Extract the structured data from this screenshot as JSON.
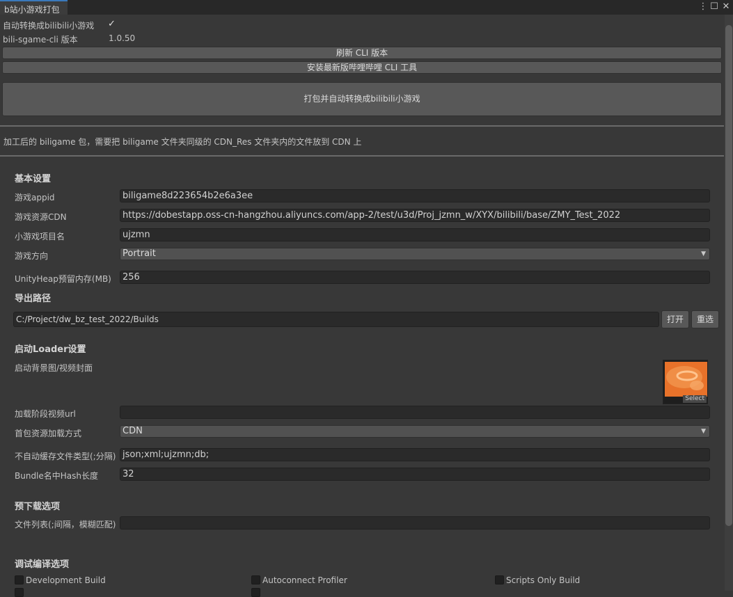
{
  "window": {
    "tab_title": "b站小游戏打包",
    "menu_icon": "⋮",
    "maximize_icon": "☐",
    "close_icon": "✕"
  },
  "top": {
    "auto_convert_label": "自动转换成bilibili小游戏",
    "auto_convert_checked": true,
    "checkmark": "✓",
    "cli_version_label": "bili-sgame-cli 版本",
    "cli_version_value": "1.0.50",
    "refresh_cli_button": "刷新 CLI 版本",
    "install_cli_button": "安装最新版哔哩哔哩 CLI 工具",
    "build_button": "打包并自动转换成bilibili小游戏",
    "note": "加工后的 biligame 包，需要把 biligame 文件夹同级的 CDN_Res 文件夹内的文件放到 CDN 上"
  },
  "basic": {
    "header": "基本设置",
    "appid_label": "游戏appid",
    "appid_value": "biligame8d223654b2e6a3ee",
    "cdn_label": "游戏资源CDN",
    "cdn_value": "https://dobestapp.oss-cn-hangzhou.aliyuncs.com/app-2/test/u3d/Proj_jzmn_w/XYX/bilibili/base/ZMY_Test_2022",
    "project_label": "小游戏项目名",
    "project_value": "ujzmn",
    "orientation_label": "游戏方向",
    "orientation_value": "Portrait",
    "heap_label": "UnityHeap预留内存(MB)",
    "heap_value": "256"
  },
  "export": {
    "header": "导出路径",
    "path_value": "C:/Project/dw_bz_test_2022/Builds",
    "open_button": "打开",
    "reselect_button": "重选"
  },
  "loader": {
    "header": "启动Loader设置",
    "bg_label": "启动背景图/视频封面",
    "select_label": "Select",
    "video_url_label": "加载阶段视频url",
    "video_url_value": "",
    "load_mode_label": "首包资源加载方式",
    "load_mode_value": "CDN",
    "nocache_label": "不自动缓存文件类型(;分隔)",
    "nocache_value": "json;xml;ujzmn;db;",
    "hash_label": "Bundle名中Hash长度",
    "hash_value": "32"
  },
  "preload": {
    "header": "预下载选项",
    "files_label": "文件列表(;间隔，模糊匹配)",
    "files_value": ""
  },
  "debug": {
    "header": "调试编译选项",
    "development_build": "Development Build",
    "autoconnect_profiler": "Autoconnect Profiler",
    "scripts_only_build": "Scripts Only Build"
  }
}
